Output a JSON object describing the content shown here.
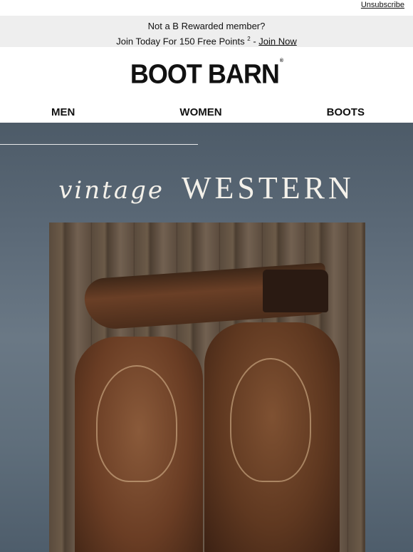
{
  "header": {
    "unsubscribe_label": "Unsubscribe"
  },
  "promo": {
    "line1": "Not a B Rewarded member?",
    "line2_text": "Join Today For 150 Free Points",
    "line2_sup": "2",
    "line2_sep": " - ",
    "join_link": "Join Now"
  },
  "brand": {
    "logo_text": "BOOT BARN",
    "registered": "®"
  },
  "nav": {
    "items": [
      {
        "label": "MEN"
      },
      {
        "label": "WOMEN"
      },
      {
        "label": "BOOTS"
      }
    ]
  },
  "hero": {
    "script_word": "vintage",
    "caps_word": "WESTERN"
  },
  "colors": {
    "promo_bg": "#eeeeee",
    "hero_sky": "#5b6977",
    "headline": "#f4f1ea"
  }
}
